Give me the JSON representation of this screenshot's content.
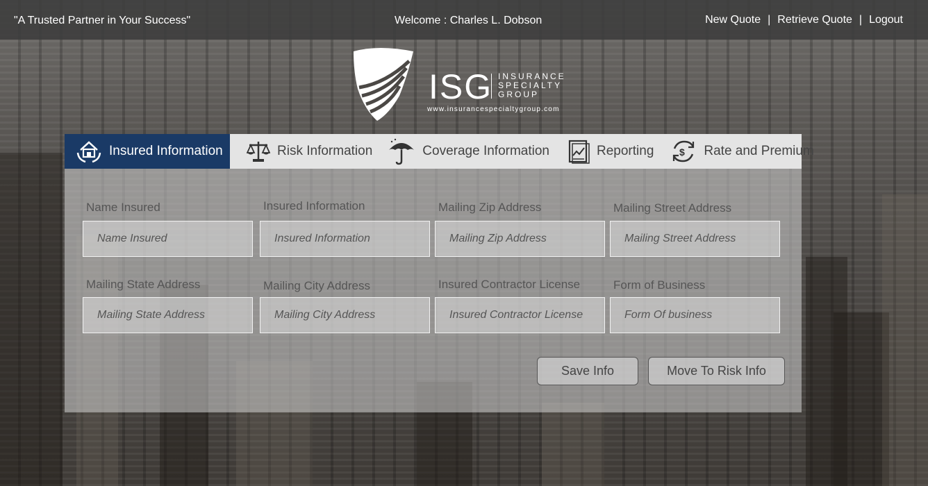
{
  "header": {
    "tagline": "\"A Trusted Partner in Your Success\"",
    "welcome": "Welcome : Charles L. Dobson",
    "links": [
      "New Quote",
      "Retrieve Quote",
      "Logout"
    ],
    "separator": "|"
  },
  "logo": {
    "name": "ISG",
    "subtitle_lines": [
      "INSURANCE",
      "SPECIALTY",
      "GROUP"
    ],
    "url": "www.insurancespecialtygroup.com"
  },
  "tabs": [
    {
      "label": "Insured Information",
      "icon": "house-hands-icon",
      "active": true
    },
    {
      "label": "Risk Information",
      "icon": "scales-icon",
      "active": false
    },
    {
      "label": "Coverage Information",
      "icon": "umbrella-icon",
      "active": false
    },
    {
      "label": "Reporting",
      "icon": "report-icon",
      "active": false
    },
    {
      "label": "Rate and Premium",
      "icon": "dollar-cycle-icon",
      "active": false
    }
  ],
  "form": {
    "fields": [
      {
        "label": "Name Insured",
        "placeholder": "Name Insured"
      },
      {
        "label": "Insured Information",
        "placeholder": "Insured Information"
      },
      {
        "label": "Mailing Zip Address",
        "placeholder": "Mailing Zip Address"
      },
      {
        "label": "Mailing Street Address",
        "placeholder": "Mailing Street Address"
      },
      {
        "label": "Mailing State Address",
        "placeholder": "Mailing State Address"
      },
      {
        "label": "Mailing City Address",
        "placeholder": "Mailing City Address"
      },
      {
        "label": "Insured Contractor License",
        "placeholder": "Insured Contractor License"
      },
      {
        "label": "Form of Business",
        "placeholder": "Form Of business"
      }
    ],
    "save_label": "Save Info",
    "next_label": "Move To Risk Info"
  },
  "colors": {
    "active_tab": "#1a3a66",
    "topbar": "#3c3c3c"
  }
}
